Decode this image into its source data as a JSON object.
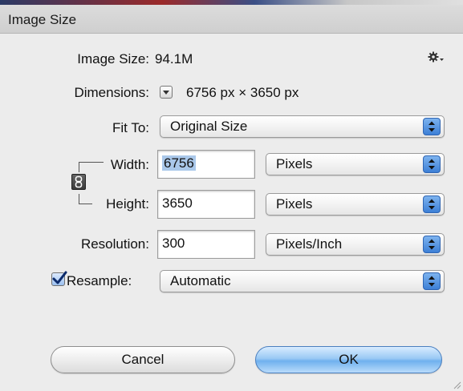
{
  "window": {
    "title": "Image Size"
  },
  "info": {
    "image_size_label": "Image Size:",
    "image_size_value": "94.1M",
    "dimensions_label": "Dimensions:",
    "dimensions_value": "6756 px  ×  3650 px"
  },
  "fit_to": {
    "label": "Fit To:",
    "value": "Original Size"
  },
  "width": {
    "label": "Width:",
    "value": "6756",
    "unit": "Pixels"
  },
  "height": {
    "label": "Height:",
    "value": "3650",
    "unit": "Pixels"
  },
  "resolution": {
    "label": "Resolution:",
    "value": "300",
    "unit": "Pixels/Inch"
  },
  "resample": {
    "label": "Resample:",
    "checked": true,
    "value": "Automatic"
  },
  "buttons": {
    "cancel": "Cancel",
    "ok": "OK"
  },
  "icons": {
    "settings": "gear-icon",
    "dimensions_menu": "triangle-down-icon",
    "constrain": "chain-link-icon",
    "popup": "up-down-arrows-icon",
    "resize": "resize-grip-icon"
  },
  "colors": {
    "selection": "#aac8ea",
    "stepper_blue": "#3c7fd6",
    "ok_button": "#6fb0ee"
  }
}
